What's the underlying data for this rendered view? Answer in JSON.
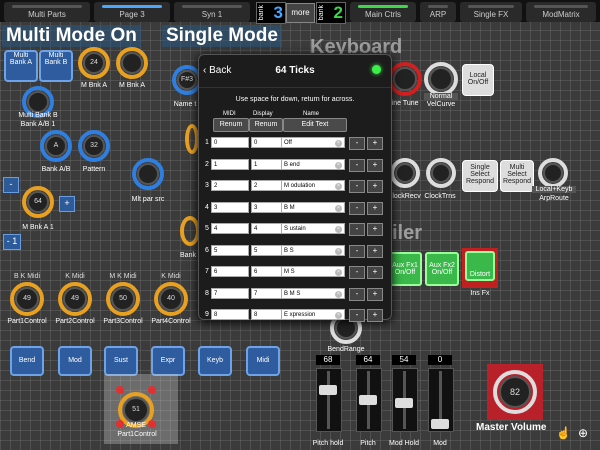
{
  "topbar": {
    "tabs": [
      "Multi Parts",
      "Page 3",
      "Syn 1",
      "Main Ctrls",
      "ARP",
      "Single FX",
      "ModMatrix"
    ],
    "bank_label": "bank",
    "bank_left_num": "3",
    "bank_right_num": "2",
    "more_label": "more"
  },
  "headers": {
    "multi_mode": "Multi Mode On",
    "single_mode": "Single Mode",
    "keyboard": "Keyboard",
    "controller": "iler"
  },
  "left": {
    "multi_bank_a": "Multi Bank A",
    "multi_bank_b": "Multi Bank B",
    "m_bnk_a_top_val": "24",
    "m_bnk_a_top": "M Bnk A",
    "m_bnk_a2": "M Bnk A",
    "multi_bank_b_label": "Multi Bank B",
    "bank_ab1": "Bank A/B 1",
    "bank_ab_val": "A",
    "bank_ab": "Bank A/B",
    "pattern_val": "32",
    "pattern": "Pattern",
    "f23": "F#3",
    "name_t": "Name t",
    "mlt_par_src": "Mlt par src",
    "m_bnk_a1_val": "64",
    "m_bnk_a1": "M Bnk A 1",
    "minus": "-",
    "plus": "+",
    "minus1": "- 1",
    "bank_label": "Bank"
  },
  "parts": [
    {
      "top": "B K Midi",
      "val": "49",
      "label": "Part1Control"
    },
    {
      "top": "K Midi",
      "val": "49",
      "label": "Part2Control"
    },
    {
      "top": "M K Midi",
      "val": "50",
      "label": "Part3Control"
    },
    {
      "top": "K Midi",
      "val": "40",
      "label": "Part4Control"
    }
  ],
  "blue_buttons": [
    "Bend",
    "Mod",
    "Sust",
    "Expr",
    "Keyb",
    "Midi"
  ],
  "selected_part": {
    "val": "51",
    "label": "Part1Control",
    "name": "AMSE"
  },
  "keyboard": {
    "fine_tune": "Fine Tune",
    "velcurve": "VelCurve",
    "normal": "Normal",
    "local_onoff": "Local On/Off",
    "clock_recv": "ClockRecv",
    "clock_trns": "ClockTrns",
    "single_select": "Single Select Respond",
    "multi_select": "Multi Select Respond",
    "local_keyb": "Local+Keyb",
    "arp_route": "ArpRoute",
    "aux_fx1": "Aux Fx1 On/Off",
    "aux_fx2": "Aux Fx2 On/Off",
    "distort": "Distort",
    "ins_fx": "Ins Fx",
    "bend_range": "BendRange"
  },
  "faders": [
    {
      "val": "68",
      "label": "Pitch hold",
      "level": 0.7
    },
    {
      "val": "64",
      "label": "Pitch",
      "level": 0.5
    },
    {
      "val": "54",
      "label": "Mod Hold",
      "level": 0.43
    },
    {
      "val": "0",
      "label": "Mod",
      "level": 0.0
    }
  ],
  "master": {
    "val": "82",
    "label": "Master Volume"
  },
  "popup": {
    "back": "Back",
    "title": "64 Ticks",
    "hint": "Use space for down, return for across.",
    "col_midi": "MIDI",
    "col_display": "Display",
    "col_name": "Name",
    "renum1": "Renum",
    "renum2": "Renum",
    "edit_text": "Edit Text",
    "rows": [
      {
        "i": "1",
        "midi": "0",
        "display": "0",
        "name": "Off"
      },
      {
        "i": "2",
        "midi": "1",
        "display": "1",
        "name": "B end"
      },
      {
        "i": "3",
        "midi": "2",
        "display": "2",
        "name": "M odulation"
      },
      {
        "i": "4",
        "midi": "3",
        "display": "3",
        "name": "B M"
      },
      {
        "i": "5",
        "midi": "4",
        "display": "4",
        "name": "S ustain"
      },
      {
        "i": "6",
        "midi": "5",
        "display": "5",
        "name": "B S"
      },
      {
        "i": "7",
        "midi": "6",
        "display": "6",
        "name": "M S"
      },
      {
        "i": "8",
        "midi": "7",
        "display": "7",
        "name": "B M S"
      },
      {
        "i": "9",
        "midi": "8",
        "display": "8",
        "name": "E xpression"
      }
    ],
    "minus": "-",
    "plus": "+"
  },
  "colors": {
    "accent_blue": "#49a7ff",
    "led_green": "#3cf04a",
    "knob_orange": "#e8a020",
    "knob_blue": "#2f7fe0",
    "master_red": "#b8202a"
  },
  "icons": [
    "back-chevron-icon",
    "zoom-icon",
    "hand-cursor-icon"
  ]
}
